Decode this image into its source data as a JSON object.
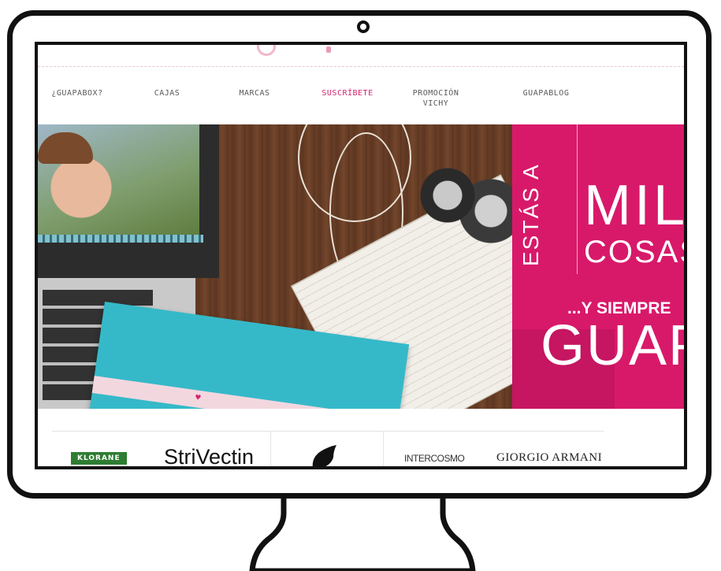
{
  "nav": {
    "items": [
      {
        "label": "¿GUAPABOX?"
      },
      {
        "label": "CAJAS"
      },
      {
        "label": "MARCAS"
      },
      {
        "label": "SUSCRÍBETE"
      },
      {
        "label": "PROMOCIÓN VICHY"
      },
      {
        "label": "GUAPABLOG"
      }
    ],
    "active_index": 3,
    "active_color": "#d6256f"
  },
  "hero": {
    "line1": "ESTÁS A",
    "line2": "MIL",
    "line3": "COSAS",
    "line4": "...Y SIEMPRE",
    "line5": "GUAPA",
    "panel_color": "#d8196a",
    "accent_color": "#35b9c9"
  },
  "brands": {
    "items": [
      {
        "label": "KLORANE"
      },
      {
        "label": "StriVectin"
      },
      {
        "label": "PHYTO"
      },
      {
        "label": "INTERCOSMO"
      },
      {
        "label": "GIORGIO ARMANI"
      }
    ]
  }
}
